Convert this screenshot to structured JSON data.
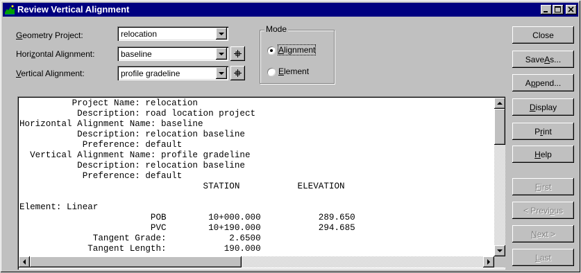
{
  "window": {
    "title": "Review Vertical Alignment",
    "buttons": {
      "minimize": "minimize-icon",
      "maximize": "maximize-icon",
      "close": "close-icon"
    }
  },
  "form": {
    "geometry_project": {
      "label_prefix": "",
      "label_accel": "G",
      "label_rest": "eometry Project:",
      "value": "relocation"
    },
    "horizontal_alignment": {
      "label_prefix": "Hori",
      "label_accel": "z",
      "label_rest": "ontal Alignment:",
      "value": "baseline"
    },
    "vertical_alignment": {
      "label_prefix": "",
      "label_accel": "V",
      "label_rest": "ertical Alignment:",
      "value": "profile gradeline"
    }
  },
  "mode": {
    "title": "Mode",
    "options": [
      {
        "accel": "A",
        "rest": "lignment",
        "selected": true
      },
      {
        "accel": "E",
        "rest": "lement",
        "selected": false
      }
    ]
  },
  "buttons": [
    {
      "prefix": "Close",
      "accel": "",
      "rest": "",
      "enabled": true
    },
    {
      "prefix": "Save ",
      "accel": "A",
      "rest": "s...",
      "enabled": true
    },
    {
      "prefix": "A",
      "accel": "p",
      "rest": "pend...",
      "enabled": true
    },
    {
      "prefix": "",
      "accel": "D",
      "rest": "isplay",
      "enabled": true
    },
    {
      "prefix": "P",
      "accel": "r",
      "rest": "int",
      "enabled": true
    },
    {
      "prefix": "",
      "accel": "H",
      "rest": "elp",
      "enabled": true
    },
    {
      "prefix": "",
      "accel": "F",
      "rest": "irst",
      "enabled": false
    },
    {
      "prefix": "< Previ",
      "accel": "o",
      "rest": "us",
      "enabled": false
    },
    {
      "prefix": "",
      "accel": "N",
      "rest": "ext >",
      "enabled": false
    },
    {
      "prefix": "",
      "accel": "L",
      "rest": "ast",
      "enabled": false
    }
  ],
  "report_lines": [
    "          Project Name: relocation",
    "           Description: road location project",
    "Horizontal Alignment Name: baseline",
    "           Description: relocation baseline",
    "            Preference: default",
    "  Vertical Alignment Name: profile gradeline",
    "           Description: relocation baseline",
    "            Preference: default",
    "                                   STATION           ELEVATION",
    "",
    "Element: Linear",
    "                         POB        10+000.000           289.650",
    "                         PVC        10+190.000           294.685",
    "              Tangent Grade:            2.6500",
    "             Tangent Length:           190.000"
  ],
  "colors": {
    "titlebar": "#000080",
    "face": "#c0c0c0",
    "disabled_text": "#808080"
  }
}
